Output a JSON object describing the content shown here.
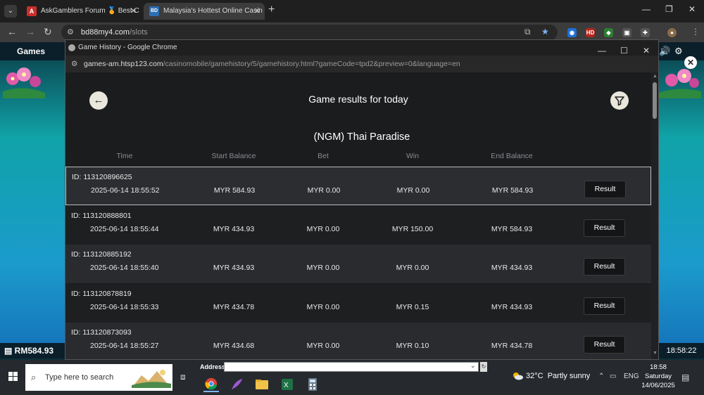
{
  "browser": {
    "tabs": [
      {
        "label": "AskGamblers Forum 🏅 Best C",
        "favicon": "A",
        "active": false
      },
      {
        "label": "Malaysia's Hottest Online Casin",
        "favicon": "BD",
        "active": true
      }
    ],
    "url_host": "bd88my4.com",
    "url_path": "/slots"
  },
  "game_page": {
    "title": "Games",
    "balance": "RM584.93",
    "clock": "18:58:22"
  },
  "popup": {
    "window_title": "Game History - Google Chrome",
    "url_host": "games-am.htsp123.com",
    "url_path": "/casinomobile/gamehistory/5/gamehistory.html?gameCode=tpd2&preview=0&language=en",
    "heading": "Game results for today",
    "game_name": "(NGM) Thai Paradise",
    "columns": [
      "Time",
      "Start Balance",
      "Bet",
      "Win",
      "End Balance"
    ],
    "id_prefix": "ID:",
    "rows": [
      {
        "id": "113120896625",
        "time": "2025-06-14  18:55:52",
        "start_balance": "MYR 584.93",
        "bet": "MYR 0.00",
        "win": "MYR 0.00",
        "end_balance": "MYR 584.93",
        "button": "Result"
      },
      {
        "id": "113120888801",
        "time": "2025-06-14  18:55:44",
        "start_balance": "MYR 434.93",
        "bet": "MYR 0.00",
        "win": "MYR 150.00",
        "end_balance": "MYR 584.93",
        "button": "Result"
      },
      {
        "id": "113120885192",
        "time": "2025-06-14  18:55:40",
        "start_balance": "MYR 434.93",
        "bet": "MYR 0.00",
        "win": "MYR 0.00",
        "end_balance": "MYR 434.93",
        "button": "Result"
      },
      {
        "id": "113120878819",
        "time": "2025-06-14  18:55:33",
        "start_balance": "MYR 434.78",
        "bet": "MYR 0.00",
        "win": "MYR 0.15",
        "end_balance": "MYR 434.93",
        "button": "Result"
      },
      {
        "id": "113120873093",
        "time": "2025-06-14  18:55:27",
        "start_balance": "MYR 434.68",
        "bet": "MYR 0.00",
        "win": "MYR 0.10",
        "end_balance": "MYR 434.78",
        "button": "Result"
      }
    ]
  },
  "taskbar": {
    "search_placeholder": "Type here to search",
    "address_label": "Address",
    "weather_temp": "32°C",
    "weather_text": "Partly sunny",
    "language": "ENG",
    "time": "18:58",
    "day": "Saturday",
    "date": "14/06/2025"
  },
  "colors": {
    "popup_bg": "#1b1c1e",
    "row_alt": "#2a2b2e",
    "accent_button": "#141517"
  }
}
